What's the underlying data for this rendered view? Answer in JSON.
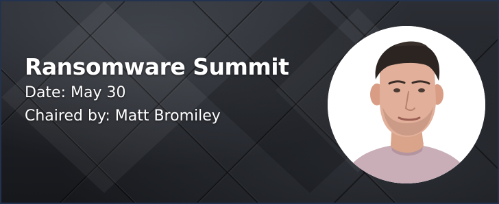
{
  "event": {
    "title": "Ransomware Summit",
    "date_line": "Date: May 30",
    "chair_line": "Chaired by: Matt Bromiley"
  },
  "speaker_photo": {
    "icon": "speaker-portrait"
  },
  "colors": {
    "text": "#ffffff",
    "background": "#1c1e23",
    "border": "#23334f",
    "photo_background": "#ffffff"
  }
}
